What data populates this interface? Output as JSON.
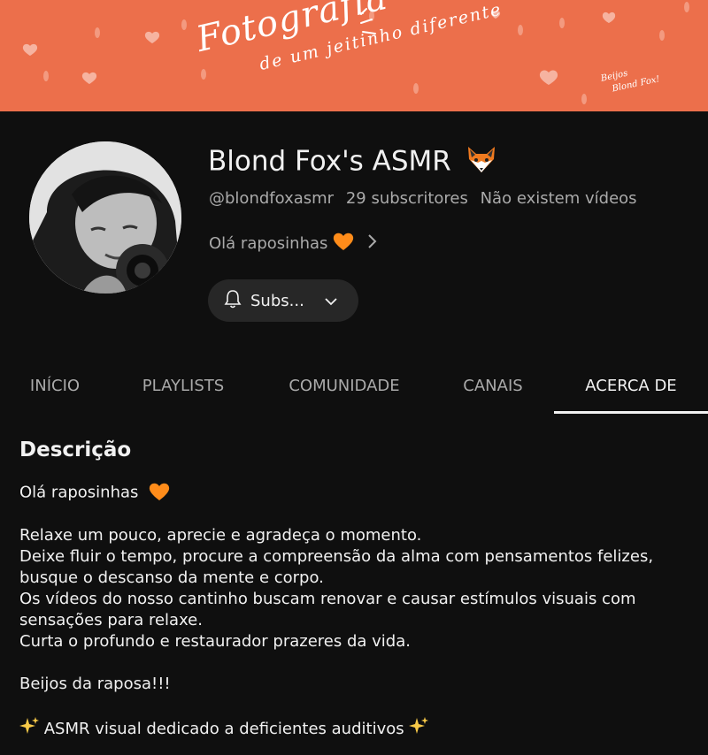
{
  "banner": {
    "title": "Fotografia",
    "subtitle": "de um jeitinho diferente",
    "signature_line1": "Beijos",
    "signature_line2": "Blond Fox!"
  },
  "channel": {
    "name": "Blond Fox's ASMR",
    "name_emoji_icon": "fox-face-icon",
    "handle": "@blondfoxasmr",
    "subscribers": "29 subscritores",
    "videos": "Não existem vídeos",
    "tagline": "Olá raposinhas"
  },
  "subscribe": {
    "label": "Subs..."
  },
  "tabs": [
    {
      "label": "INÍCIO"
    },
    {
      "label": "PLAYLISTS"
    },
    {
      "label": "COMUNIDADE"
    },
    {
      "label": "CANAIS"
    },
    {
      "label": "ACERCA DE",
      "active": true
    }
  ],
  "description": {
    "heading": "Descrição",
    "greeting": "Olá raposinhas",
    "p1": "Relaxe um pouco, aprecie e agradeça o momento.",
    "p2a": "Deixe fluir o tempo, procure a compreensão da alma com pensamentos felizes,",
    "p2b": "busque o descanso da mente e corpo.",
    "p3a": "Os vídeos do nosso cantinho buscam renovar e causar estímulos visuais com",
    "p3b": "sensações para relaxe.",
    "p4": "Curta o profundo e restaurador prazeres da vida.",
    "closing": "Beijos da raposa!!!",
    "footer": "ASMR visual dedicado a deficientes auditivos"
  },
  "colors": {
    "banner": "#ec6f4b",
    "background": "#0f0f0f",
    "text_primary": "#f1f1f1",
    "text_secondary": "#aaaaaa",
    "button_bg": "#272727",
    "heart": "#ff8c1a"
  }
}
